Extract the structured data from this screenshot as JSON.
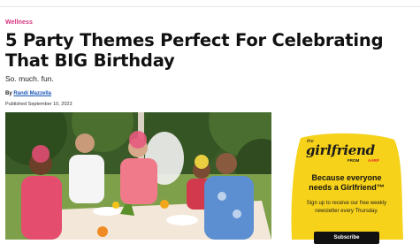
{
  "article": {
    "category": "Wellness",
    "title": "5 Party Themes Perfect For Celebrating That BIG Birthday",
    "subtitle": "So. much. fun.",
    "byline_prefix": "By ",
    "author": "Randi Mazzella",
    "published": "Published September 10, 2023"
  },
  "hero_image": {
    "description_icon": "photo-icon",
    "colors": {
      "foliage": "#3d5b2a",
      "grass": "#7fa04a",
      "table": "#f3e7d9"
    }
  },
  "promo": {
    "logo_the": "the",
    "logo_word": "girlfriend",
    "logo_from": "FROM",
    "logo_brand": "AARP",
    "headline_line1": "Because everyone",
    "headline_line2": "needs a Girlfriend™",
    "body_line1": "Sign up to receive our free weekly",
    "body_line2": "newsletter every Thursday.",
    "button_label": "Subscribe",
    "colors": {
      "background": "#f7d21a",
      "brand_red": "#e3262b"
    }
  }
}
